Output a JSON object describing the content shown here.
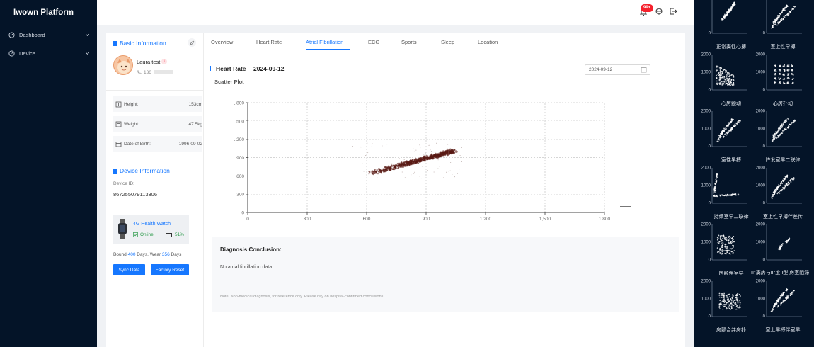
{
  "app": {
    "title": "Iwown Platform"
  },
  "sidebar": {
    "items": [
      {
        "label": "Dashboard",
        "icon": "dashboard-icon"
      },
      {
        "label": "Device",
        "icon": "device-icon"
      }
    ]
  },
  "header": {
    "notification_badge": "99+",
    "icons": [
      "bell-icon",
      "globe-icon",
      "logout-icon"
    ]
  },
  "basic_info": {
    "title": "Basic Information",
    "user_name": "Laura test",
    "phone": "136",
    "height_label": "Height:",
    "height_value": "153cm",
    "weight_label": "Weight:",
    "weight_value": "47.5kg",
    "dob_label": "Date of Birth:",
    "dob_value": "1996-09-02"
  },
  "device_info": {
    "title": "Device Information",
    "id_label": "Device ID:",
    "id_value": "867255079113306",
    "model": "4G Health Watch",
    "status": "Online",
    "battery": "51%",
    "bound_prefix": "Bound ",
    "bound_days": "400",
    "bound_mid": " Days, Wear ",
    "wear_days": "356",
    "bound_suffix": " Days",
    "sync_button": "Sync Data",
    "reset_button": "Factory Reset"
  },
  "tabs": [
    {
      "label": "Overview",
      "active": false
    },
    {
      "label": "Heart Rate",
      "active": false
    },
    {
      "label": "Atrial Fibrillation",
      "active": true
    },
    {
      "label": "ECG",
      "active": false
    },
    {
      "label": "Sports",
      "active": false
    },
    {
      "label": "Sleep",
      "active": false
    },
    {
      "label": "Location",
      "active": false
    }
  ],
  "heart_rate": {
    "title": "Heart Rate",
    "date": "2024-09-12",
    "date_input": "2024-09-12",
    "scatter_title": "Scatter Plot"
  },
  "chart_data": {
    "type": "scatter",
    "title": "Scatter Plot",
    "xlabel": "",
    "ylabel": "",
    "xlim": [
      0,
      1800
    ],
    "ylim": [
      0,
      1800
    ],
    "x_ticks": [
      "0",
      "300",
      "600",
      "900",
      "1,200",
      "1,500",
      "1,800"
    ],
    "y_ticks": [
      "0",
      "300",
      "600",
      "900",
      "1,200",
      "1,500",
      "1,800"
    ],
    "grid": true,
    "series": [
      {
        "color": "#5a1a14",
        "cluster": {
          "x_from": 620,
          "x_to": 1040,
          "y_from": 640,
          "y_to": 1010
        }
      }
    ]
  },
  "diagnosis": {
    "title": "Diagnosis Conclusion:",
    "text": "No atrial fibrillation data",
    "note": "Note: Non-medical diagnosis, for reference only. Please rely on hospital-confirmed conclusions."
  },
  "reference_plots": {
    "axis_ticks": [
      "0",
      "1000",
      "2000"
    ],
    "items": [
      {
        "label": "正常窦性心搏",
        "pattern": "normal"
      },
      {
        "label": "室上性早搏",
        "pattern": "sve"
      },
      {
        "label": "心房颤动",
        "pattern": "afib"
      },
      {
        "label": "心房扑动",
        "pattern": "aflutter"
      },
      {
        "label": "室性早搏",
        "pattern": "pvc"
      },
      {
        "label": "阵发室早二联律",
        "pattern": "bigeminy"
      },
      {
        "label": "持续室早二联律",
        "pattern": "sustained"
      },
      {
        "label": "室上性早搏伴差传",
        "pattern": "aberrant"
      },
      {
        "label": "房颤伴室早",
        "pattern": "afpvc"
      },
      {
        "label": "II°窦房与II°度II型 房室阻滞",
        "pattern": "block"
      },
      {
        "label": "房颤合并房扑",
        "pattern": "afflutter"
      },
      {
        "label": "室上早搏伴室早",
        "pattern": "svepvc"
      }
    ]
  }
}
